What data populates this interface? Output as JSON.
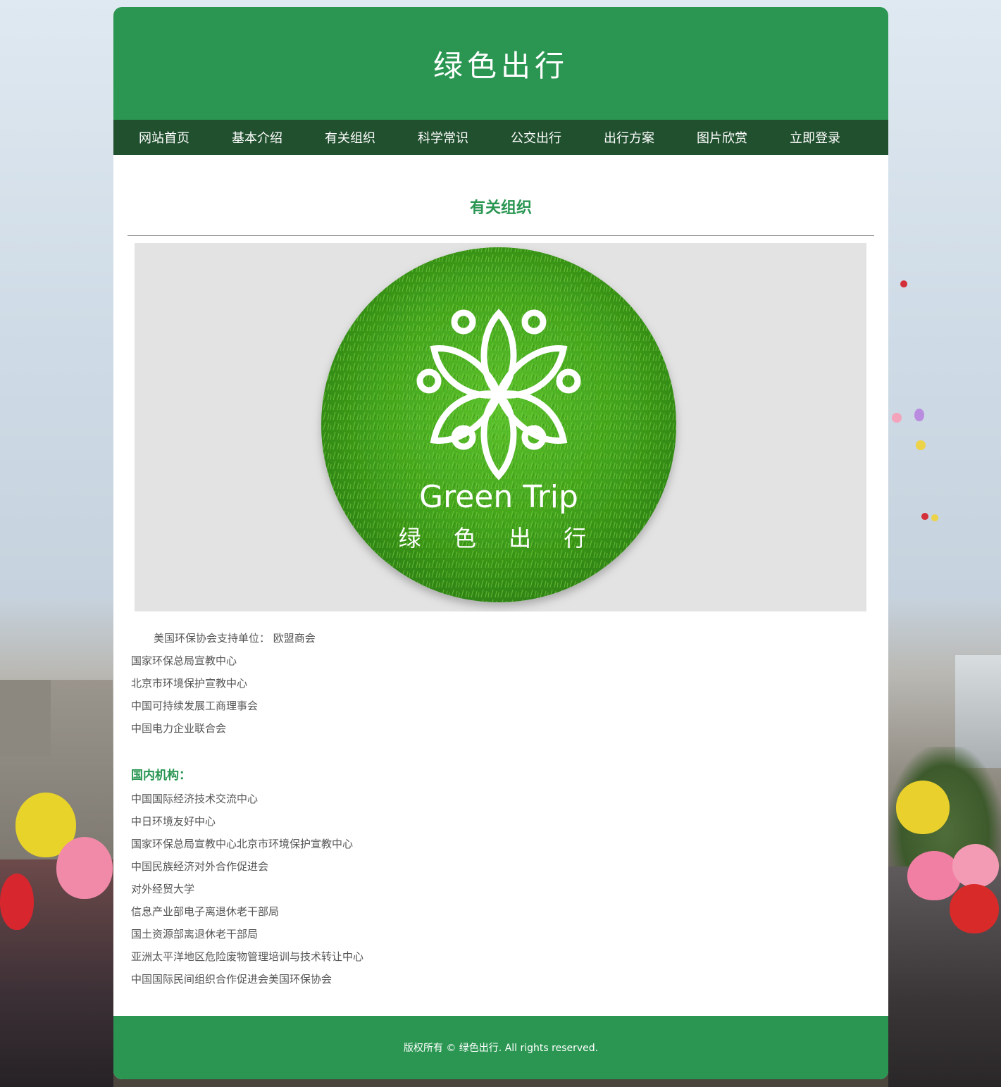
{
  "site": {
    "title": "绿色出行"
  },
  "nav": {
    "items": [
      {
        "label": "网站首页"
      },
      {
        "label": "基本介绍"
      },
      {
        "label": "有关组织"
      },
      {
        "label": "科学常识"
      },
      {
        "label": "公交出行"
      },
      {
        "label": "出行方案"
      },
      {
        "label": "图片欣赏"
      },
      {
        "label": "立即登录"
      }
    ]
  },
  "main": {
    "section_title": "有关组织",
    "hero": {
      "logo_text_en": "Green Trip",
      "logo_text_cn": "绿 色 出 行",
      "icon": "flower-leaf-logo"
    },
    "support_lines": [
      "美国环保协会支持单位： 欧盟商会",
      "国家环保总局宣教中心",
      "北京市环境保护宣教中心",
      "中国可持续发展工商理事会",
      "中国电力企业联合会"
    ],
    "domestic_heading": "国内机构：",
    "domestic_lines": [
      "中国国际经济技术交流中心",
      "中日环境友好中心",
      "国家环保总局宣教中心北京市环境保护宣教中心",
      "中国民族经济对外合作促进会",
      "对外经贸大学",
      "信息产业部电子离退休老干部局",
      "国土资源部离退休老干部局",
      "亚洲太平洋地区危险废物管理培训与技术转让中心",
      "中国国际民间组织合作促进会美国环保协会"
    ]
  },
  "footer": {
    "copyright": "版权所有 © 绿色出行. All rights reserved."
  },
  "colors": {
    "brand_green": "#2a9652",
    "nav_dark_green": "#21502f",
    "text_gray": "#555555",
    "hero_bg": "#e3e3e3"
  }
}
